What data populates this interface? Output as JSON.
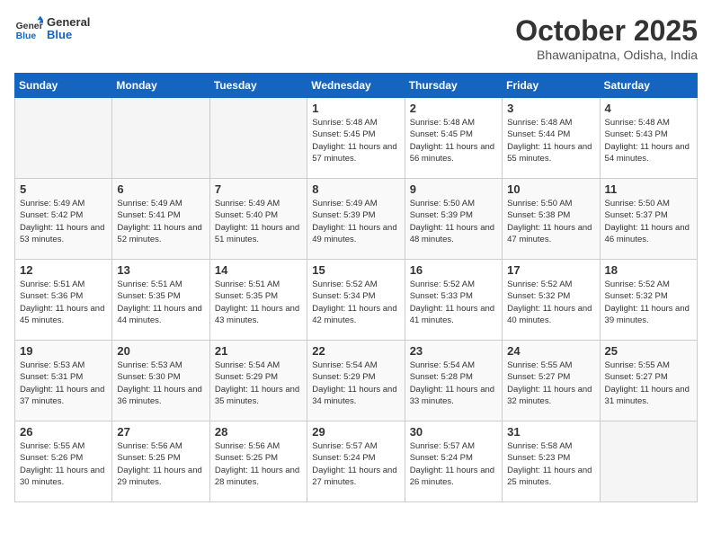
{
  "logo": {
    "line1": "General",
    "line2": "Blue"
  },
  "title": "October 2025",
  "location": "Bhawanipatna, Odisha, India",
  "weekdays": [
    "Sunday",
    "Monday",
    "Tuesday",
    "Wednesday",
    "Thursday",
    "Friday",
    "Saturday"
  ],
  "weeks": [
    [
      {
        "day": "",
        "sunrise": "",
        "sunset": "",
        "daylight": ""
      },
      {
        "day": "",
        "sunrise": "",
        "sunset": "",
        "daylight": ""
      },
      {
        "day": "",
        "sunrise": "",
        "sunset": "",
        "daylight": ""
      },
      {
        "day": "1",
        "sunrise": "Sunrise: 5:48 AM",
        "sunset": "Sunset: 5:45 PM",
        "daylight": "Daylight: 11 hours and 57 minutes."
      },
      {
        "day": "2",
        "sunrise": "Sunrise: 5:48 AM",
        "sunset": "Sunset: 5:45 PM",
        "daylight": "Daylight: 11 hours and 56 minutes."
      },
      {
        "day": "3",
        "sunrise": "Sunrise: 5:48 AM",
        "sunset": "Sunset: 5:44 PM",
        "daylight": "Daylight: 11 hours and 55 minutes."
      },
      {
        "day": "4",
        "sunrise": "Sunrise: 5:48 AM",
        "sunset": "Sunset: 5:43 PM",
        "daylight": "Daylight: 11 hours and 54 minutes."
      }
    ],
    [
      {
        "day": "5",
        "sunrise": "Sunrise: 5:49 AM",
        "sunset": "Sunset: 5:42 PM",
        "daylight": "Daylight: 11 hours and 53 minutes."
      },
      {
        "day": "6",
        "sunrise": "Sunrise: 5:49 AM",
        "sunset": "Sunset: 5:41 PM",
        "daylight": "Daylight: 11 hours and 52 minutes."
      },
      {
        "day": "7",
        "sunrise": "Sunrise: 5:49 AM",
        "sunset": "Sunset: 5:40 PM",
        "daylight": "Daylight: 11 hours and 51 minutes."
      },
      {
        "day": "8",
        "sunrise": "Sunrise: 5:49 AM",
        "sunset": "Sunset: 5:39 PM",
        "daylight": "Daylight: 11 hours and 49 minutes."
      },
      {
        "day": "9",
        "sunrise": "Sunrise: 5:50 AM",
        "sunset": "Sunset: 5:39 PM",
        "daylight": "Daylight: 11 hours and 48 minutes."
      },
      {
        "day": "10",
        "sunrise": "Sunrise: 5:50 AM",
        "sunset": "Sunset: 5:38 PM",
        "daylight": "Daylight: 11 hours and 47 minutes."
      },
      {
        "day": "11",
        "sunrise": "Sunrise: 5:50 AM",
        "sunset": "Sunset: 5:37 PM",
        "daylight": "Daylight: 11 hours and 46 minutes."
      }
    ],
    [
      {
        "day": "12",
        "sunrise": "Sunrise: 5:51 AM",
        "sunset": "Sunset: 5:36 PM",
        "daylight": "Daylight: 11 hours and 45 minutes."
      },
      {
        "day": "13",
        "sunrise": "Sunrise: 5:51 AM",
        "sunset": "Sunset: 5:35 PM",
        "daylight": "Daylight: 11 hours and 44 minutes."
      },
      {
        "day": "14",
        "sunrise": "Sunrise: 5:51 AM",
        "sunset": "Sunset: 5:35 PM",
        "daylight": "Daylight: 11 hours and 43 minutes."
      },
      {
        "day": "15",
        "sunrise": "Sunrise: 5:52 AM",
        "sunset": "Sunset: 5:34 PM",
        "daylight": "Daylight: 11 hours and 42 minutes."
      },
      {
        "day": "16",
        "sunrise": "Sunrise: 5:52 AM",
        "sunset": "Sunset: 5:33 PM",
        "daylight": "Daylight: 11 hours and 41 minutes."
      },
      {
        "day": "17",
        "sunrise": "Sunrise: 5:52 AM",
        "sunset": "Sunset: 5:32 PM",
        "daylight": "Daylight: 11 hours and 40 minutes."
      },
      {
        "day": "18",
        "sunrise": "Sunrise: 5:52 AM",
        "sunset": "Sunset: 5:32 PM",
        "daylight": "Daylight: 11 hours and 39 minutes."
      }
    ],
    [
      {
        "day": "19",
        "sunrise": "Sunrise: 5:53 AM",
        "sunset": "Sunset: 5:31 PM",
        "daylight": "Daylight: 11 hours and 37 minutes."
      },
      {
        "day": "20",
        "sunrise": "Sunrise: 5:53 AM",
        "sunset": "Sunset: 5:30 PM",
        "daylight": "Daylight: 11 hours and 36 minutes."
      },
      {
        "day": "21",
        "sunrise": "Sunrise: 5:54 AM",
        "sunset": "Sunset: 5:29 PM",
        "daylight": "Daylight: 11 hours and 35 minutes."
      },
      {
        "day": "22",
        "sunrise": "Sunrise: 5:54 AM",
        "sunset": "Sunset: 5:29 PM",
        "daylight": "Daylight: 11 hours and 34 minutes."
      },
      {
        "day": "23",
        "sunrise": "Sunrise: 5:54 AM",
        "sunset": "Sunset: 5:28 PM",
        "daylight": "Daylight: 11 hours and 33 minutes."
      },
      {
        "day": "24",
        "sunrise": "Sunrise: 5:55 AM",
        "sunset": "Sunset: 5:27 PM",
        "daylight": "Daylight: 11 hours and 32 minutes."
      },
      {
        "day": "25",
        "sunrise": "Sunrise: 5:55 AM",
        "sunset": "Sunset: 5:27 PM",
        "daylight": "Daylight: 11 hours and 31 minutes."
      }
    ],
    [
      {
        "day": "26",
        "sunrise": "Sunrise: 5:55 AM",
        "sunset": "Sunset: 5:26 PM",
        "daylight": "Daylight: 11 hours and 30 minutes."
      },
      {
        "day": "27",
        "sunrise": "Sunrise: 5:56 AM",
        "sunset": "Sunset: 5:25 PM",
        "daylight": "Daylight: 11 hours and 29 minutes."
      },
      {
        "day": "28",
        "sunrise": "Sunrise: 5:56 AM",
        "sunset": "Sunset: 5:25 PM",
        "daylight": "Daylight: 11 hours and 28 minutes."
      },
      {
        "day": "29",
        "sunrise": "Sunrise: 5:57 AM",
        "sunset": "Sunset: 5:24 PM",
        "daylight": "Daylight: 11 hours and 27 minutes."
      },
      {
        "day": "30",
        "sunrise": "Sunrise: 5:57 AM",
        "sunset": "Sunset: 5:24 PM",
        "daylight": "Daylight: 11 hours and 26 minutes."
      },
      {
        "day": "31",
        "sunrise": "Sunrise: 5:58 AM",
        "sunset": "Sunset: 5:23 PM",
        "daylight": "Daylight: 11 hours and 25 minutes."
      },
      {
        "day": "",
        "sunrise": "",
        "sunset": "",
        "daylight": ""
      }
    ]
  ]
}
